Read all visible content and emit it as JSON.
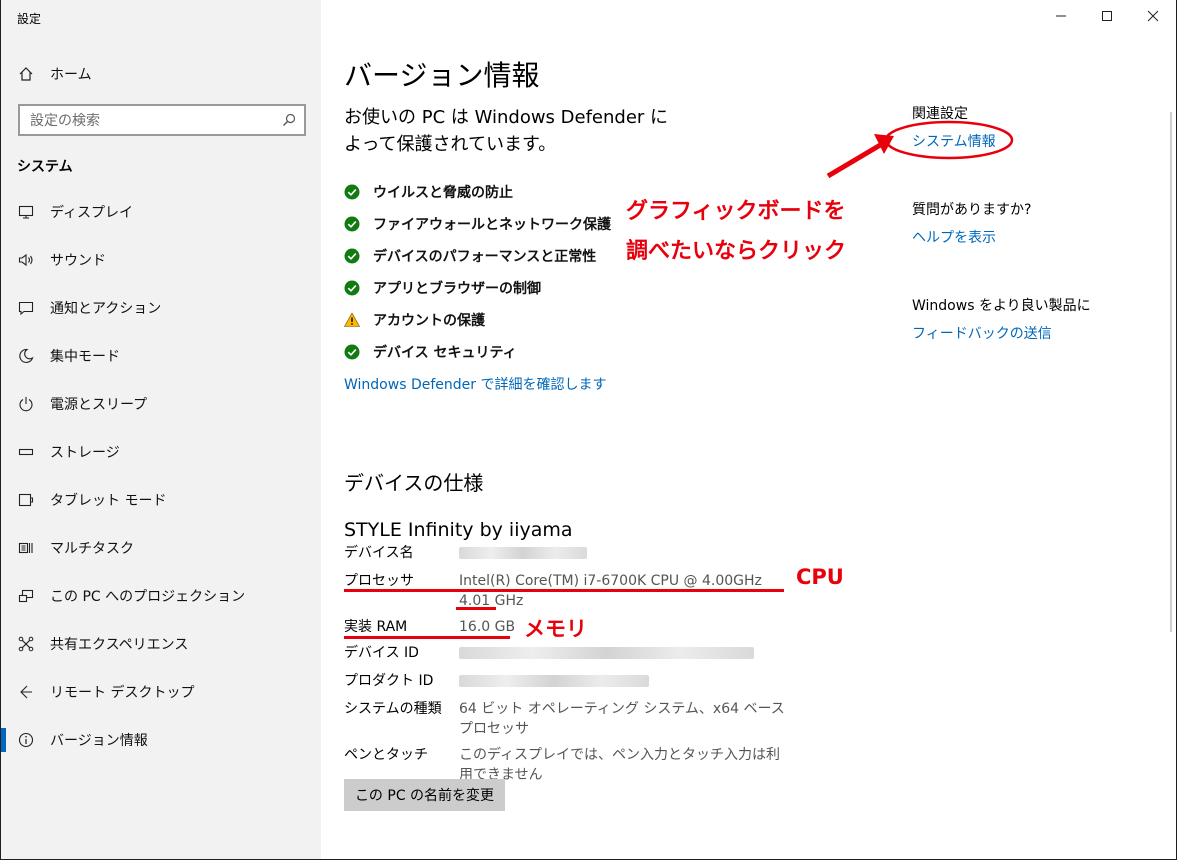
{
  "window": {
    "title": "設定",
    "minimize_icon": "minimize-icon",
    "maximize_icon": "maximize-icon",
    "close_icon": "close-icon"
  },
  "sidebar": {
    "home_label": "ホーム",
    "search_placeholder": "設定の検索",
    "section_title": "システム",
    "items": [
      {
        "label": "ディスプレイ",
        "icon": "display-icon"
      },
      {
        "label": "サウンド",
        "icon": "speaker-icon"
      },
      {
        "label": "通知とアクション",
        "icon": "notification-icon"
      },
      {
        "label": "集中モード",
        "icon": "moon-icon"
      },
      {
        "label": "電源とスリープ",
        "icon": "power-icon"
      },
      {
        "label": "ストレージ",
        "icon": "storage-icon"
      },
      {
        "label": "タブレット モード",
        "icon": "tablet-icon"
      },
      {
        "label": "マルチタスク",
        "icon": "multitask-icon"
      },
      {
        "label": "この PC へのプロジェクション",
        "icon": "projection-icon"
      },
      {
        "label": "共有エクスペリエンス",
        "icon": "share-icon"
      },
      {
        "label": "リモート デスクトップ",
        "icon": "remote-icon"
      },
      {
        "label": "バージョン情報",
        "icon": "info-icon",
        "active": true
      }
    ]
  },
  "main": {
    "title": "バージョン情報",
    "protection_line1": "お使いの PC は Windows Defender に",
    "protection_line2": "よって保護されています。",
    "security_items": [
      {
        "label": "ウイルスと脅威の防止",
        "status": "ok"
      },
      {
        "label": "ファイアウォールとネットワーク保護",
        "status": "ok"
      },
      {
        "label": "デバイスのパフォーマンスと正常性",
        "status": "ok"
      },
      {
        "label": "アプリとブラウザーの制御",
        "status": "ok"
      },
      {
        "label": "アカウントの保護",
        "status": "warning"
      },
      {
        "label": "デバイス セキュリティ",
        "status": "ok"
      }
    ],
    "defender_link": "Windows Defender で詳細を確認します",
    "device_spec_title": "デバイスの仕様",
    "device_model": "STYLE Infinity by iiyama",
    "specs": {
      "device_name_key": "デバイス名",
      "processor_key": "プロセッサ",
      "processor_val": "Intel(R) Core(TM) i7-6700K CPU @ 4.00GHz   4.01 GHz",
      "ram_key": "実装 RAM",
      "ram_val": "16.0 GB",
      "device_id_key": "デバイス ID",
      "product_id_key": "プロダクト ID",
      "system_type_key": "システムの種類",
      "system_type_val": "64 ビット オペレーティング システム、x64 ベース プロセッサ",
      "pen_key": "ペンとタッチ",
      "pen_val": "このディスプレイでは、ペン入力とタッチ入力は利用できません"
    },
    "rename_button": "この PC の名前を変更"
  },
  "related": {
    "heading": "関連設定",
    "system_info_link": "システム情報",
    "question_heading": "質問がありますか?",
    "help_link": "ヘルプを表示",
    "feedback_heading": "Windows をより良い製品に",
    "feedback_link": "フィードバックの送信"
  },
  "annotations": {
    "gpu_line1": "グラフィックボードを",
    "gpu_line2": "調べたいならクリック",
    "cpu": "CPU",
    "memory": "メモリ",
    "color": "#e8000d"
  },
  "colors": {
    "link": "#0067b8",
    "accent": "#0067c0",
    "ok": "#107c10",
    "warning": "#fcb900"
  }
}
